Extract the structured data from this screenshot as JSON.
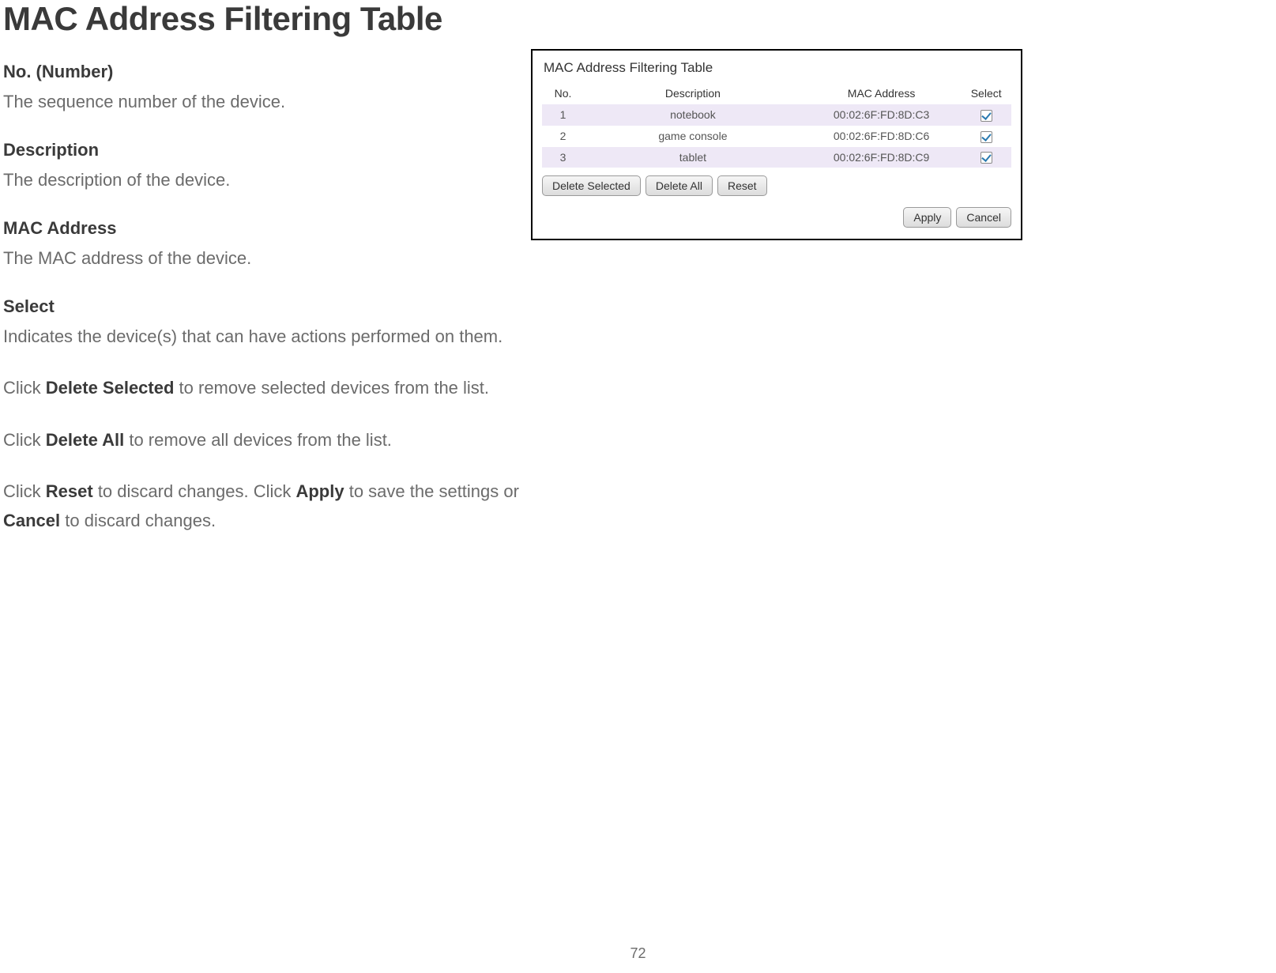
{
  "pageTitle": "MAC Address Filtering Table",
  "definitions": [
    {
      "term": "No. (Number)",
      "desc": "The sequence number of the device."
    },
    {
      "term": "Description",
      "desc": "The description of the device."
    },
    {
      "term": "MAC Address",
      "desc": "The MAC address of the device."
    },
    {
      "term": "Select",
      "desc": "Indicates the device(s) that can have actions performed on them."
    }
  ],
  "paragraphs": {
    "p1_pre": "Click ",
    "p1_b": "Delete Selected",
    "p1_post": " to remove selected devices from the list.",
    "p2_pre": "Click ",
    "p2_b": "Delete All",
    "p2_post": " to remove all devices from the list.",
    "p3_pre": "Click ",
    "p3_b1": "Reset",
    "p3_mid1": " to discard changes. Click ",
    "p3_b2": "Apply",
    "p3_mid2": " to save the settings or ",
    "p3_b3": "Cancel",
    "p3_post": " to discard changes."
  },
  "panel": {
    "title": "MAC Address Filtering Table",
    "headers": {
      "no": "No.",
      "desc": "Description",
      "mac": "MAC Address",
      "sel": "Select"
    },
    "rows": [
      {
        "no": "1",
        "desc": "notebook",
        "mac": "00:02:6F:FD:8D:C3",
        "checked": true
      },
      {
        "no": "2",
        "desc": "game console",
        "mac": "00:02:6F:FD:8D:C6",
        "checked": true
      },
      {
        "no": "3",
        "desc": "tablet",
        "mac": "00:02:6F:FD:8D:C9",
        "checked": true
      }
    ],
    "buttons": {
      "deleteSelected": "Delete Selected",
      "deleteAll": "Delete All",
      "reset": "Reset",
      "apply": "Apply",
      "cancel": "Cancel"
    }
  },
  "pageNumber": "72"
}
